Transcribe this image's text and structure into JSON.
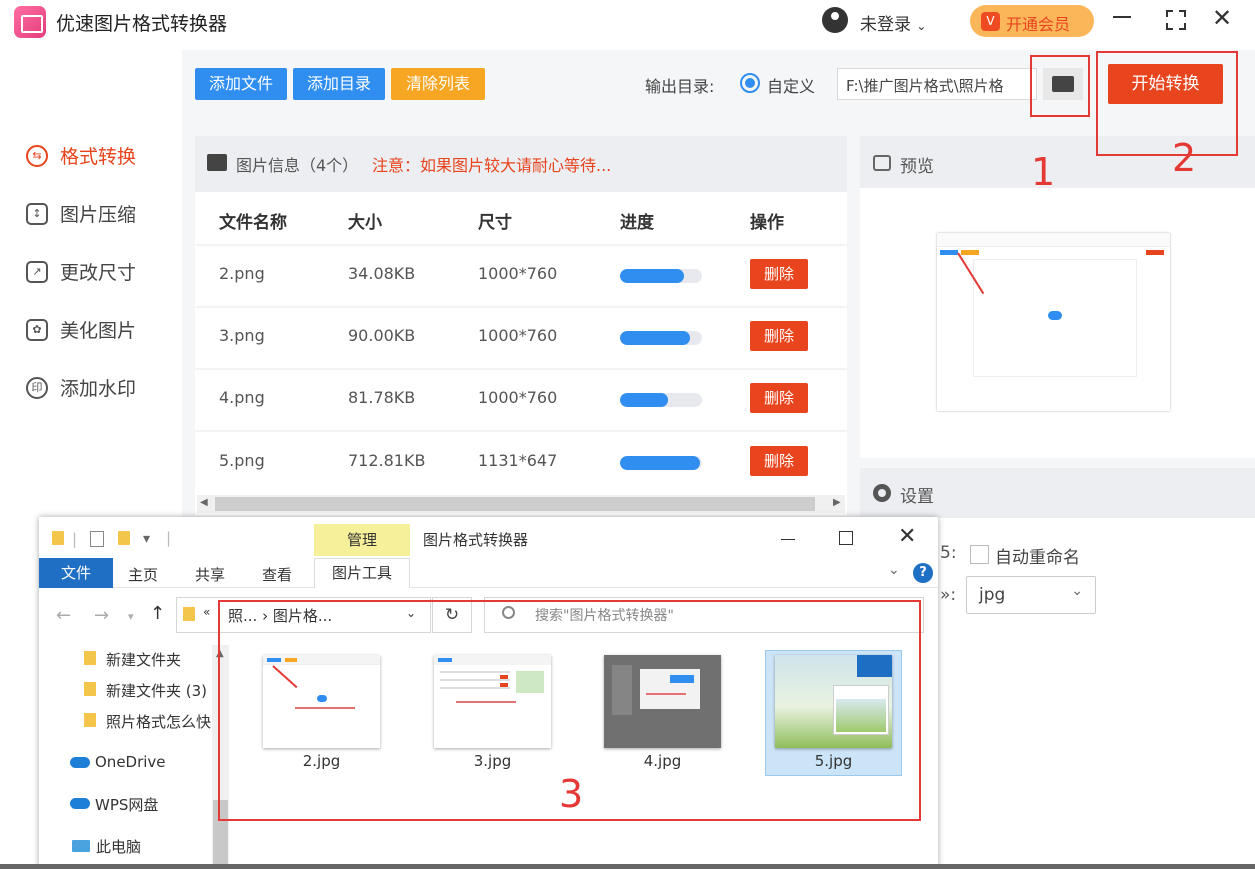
{
  "app": {
    "title": "优速图片格式转换器",
    "login_text": "未登录",
    "vip_label": "开通会员",
    "vip_icon": "V"
  },
  "sidebar": {
    "items": [
      {
        "label": "格式转换",
        "icon": "exchange-icon",
        "glyph": "⇆",
        "active": true
      },
      {
        "label": "图片压缩",
        "icon": "compress-icon",
        "glyph": "↕",
        "active": false
      },
      {
        "label": "更改尺寸",
        "icon": "resize-icon",
        "glyph": "↗",
        "active": false
      },
      {
        "label": "美化图片",
        "icon": "beautify-icon",
        "glyph": "✿",
        "active": false
      },
      {
        "label": "添加水印",
        "icon": "watermark-icon",
        "glyph": "印",
        "active": false
      }
    ]
  },
  "toolbar": {
    "add_file": "添加文件",
    "add_dir": "添加目录",
    "clear_list": "清除列表",
    "output_label": "输出目录:",
    "radio_label": "自定义",
    "output_path": "F:\\推广图片格式\\照片格",
    "start_button": "开始转换"
  },
  "file_table": {
    "info_title": "图片信息（4个）",
    "info_note": "注意：如果图片较大请耐心等待...",
    "headers": [
      "文件名称",
      "大小",
      "尺寸",
      "进度",
      "操作"
    ],
    "rows": [
      {
        "name": "2.png",
        "size": "34.08KB",
        "dim": "1000*760",
        "progress": 0.78,
        "action": "删除"
      },
      {
        "name": "3.png",
        "size": "90.00KB",
        "dim": "1000*760",
        "progress": 0.85,
        "action": "删除"
      },
      {
        "name": "4.png",
        "size": "81.78KB",
        "dim": "1000*760",
        "progress": 0.58,
        "action": "删除"
      },
      {
        "name": "5.png",
        "size": "712.81KB",
        "dim": "1131*647",
        "progress": 0.97,
        "action": "删除"
      }
    ]
  },
  "preview": {
    "title": "预览"
  },
  "settings": {
    "title": "设置",
    "colon_1": "5:",
    "colon_2": "»:",
    "auto_rename": "自动重命名",
    "format_value": "jpg"
  },
  "explorer": {
    "manage_tab": "管理",
    "window_title": "图片格式转换器",
    "tabs": {
      "file": "文件",
      "home": "主页",
      "share": "共享",
      "view": "查看",
      "picture_tools": "图片工具"
    },
    "address": "照... › 图片格...",
    "search_placeholder": "搜索\"图片格式转换器\"",
    "tree": [
      {
        "label": "新建文件夹",
        "icon": "folder-icon"
      },
      {
        "label": "新建文件夹 (3)",
        "icon": "folder-icon"
      },
      {
        "label": "照片格式怎么快",
        "icon": "folder-icon"
      },
      {
        "label": "OneDrive",
        "icon": "onedrive-icon"
      },
      {
        "label": "WPS网盘",
        "icon": "wps-cloud-icon"
      },
      {
        "label": "此电脑",
        "icon": "computer-icon"
      }
    ],
    "files": [
      {
        "name": "2.jpg",
        "selected": false
      },
      {
        "name": "3.jpg",
        "selected": false
      },
      {
        "name": "4.jpg",
        "selected": false
      },
      {
        "name": "5.jpg",
        "selected": true
      }
    ]
  },
  "annotations": {
    "label_1": "1",
    "label_2": "2",
    "label_3": "3",
    "color": "#e53935"
  },
  "colors": {
    "accent_orange": "#e8441d",
    "accent_blue": "#2f8ef0",
    "clear_orange": "#f7a623"
  }
}
